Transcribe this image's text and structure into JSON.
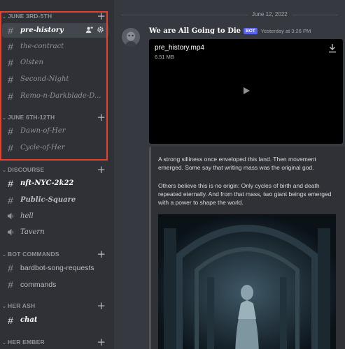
{
  "sidebar": {
    "categories": [
      {
        "label": "JUNE 3RD-5TH"
      },
      {
        "label": "JUNE 6TH-12TH"
      },
      {
        "label": "DISCOURSE"
      },
      {
        "label": "BOT COMMANDS"
      },
      {
        "label": "HER ASH"
      },
      {
        "label": "HER EMBER"
      }
    ],
    "channels": [
      {
        "name": "pre-history",
        "type": "text"
      },
      {
        "name": "the-contract",
        "type": "text"
      },
      {
        "name": "Olsten",
        "type": "text"
      },
      {
        "name": "Second-Night",
        "type": "text"
      },
      {
        "name": "Remo-n-Darkblade-D...",
        "type": "text"
      },
      {
        "name": "Dawn-of-Her",
        "type": "text"
      },
      {
        "name": "Cycle-of-Her",
        "type": "text"
      },
      {
        "name": "nft-NYC-2k22",
        "type": "text"
      },
      {
        "name": "Public-Square",
        "type": "text"
      },
      {
        "name": "hell",
        "type": "voice"
      },
      {
        "name": "Tavern",
        "type": "voice"
      },
      {
        "name": "bardbot-song-requests",
        "type": "text"
      },
      {
        "name": "commands",
        "type": "text"
      },
      {
        "name": "chat",
        "type": "text"
      }
    ],
    "icons": {
      "category": "chevron-down-icon",
      "add": "plus-icon",
      "invite": "add-member-icon",
      "settings": "gear-icon"
    }
  },
  "main": {
    "date_divider": "June 12, 2022",
    "message": {
      "username": "We are All Going to Die",
      "bot_tag": "BOT",
      "timestamp": "Yesterday at 3:26 PM",
      "attachment": {
        "filename": "pre_history.mp4",
        "size": "6.51 MB"
      },
      "embed": {
        "paragraph_1": "A strong silliness once enveloped this land. Then movement emerged. Some say that writing mass was the original god.",
        "paragraph_2": "Others believe this is no origin: Only cycles of birth and death repeated eternally. And from that mass, two giant beings emerged with a power to shape the world."
      }
    }
  },
  "colors": {
    "highlight": "#e8412e",
    "bot_tag": "#5865f2",
    "sidebar_bg": "#2f3136",
    "main_bg": "#36393f"
  }
}
